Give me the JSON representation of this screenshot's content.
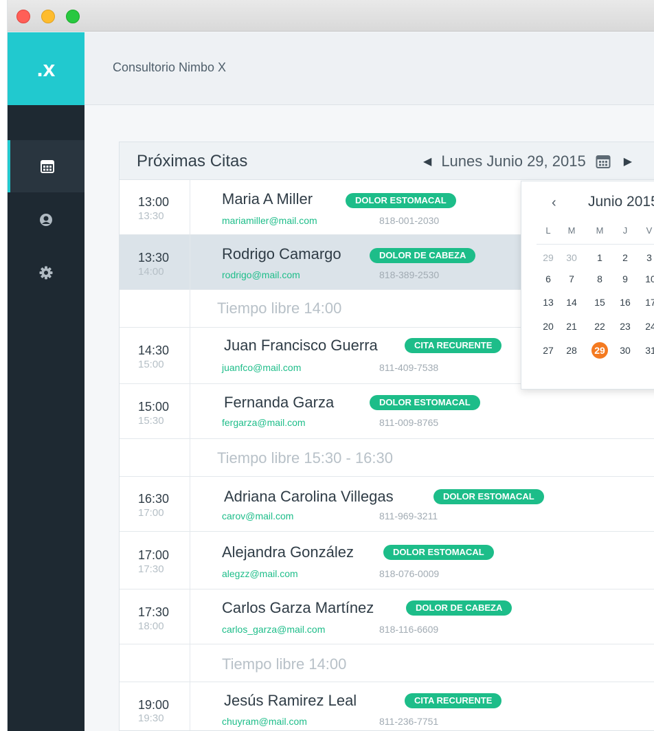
{
  "app": {
    "logo": ".x",
    "name": "Consultorio Nimbo X"
  },
  "sidebar": {
    "items": [
      {
        "icon": "calendar-icon",
        "active": true
      },
      {
        "icon": "user-icon",
        "active": false
      },
      {
        "icon": "gear-icon",
        "active": false
      }
    ]
  },
  "panel": {
    "title": "Próximas Citas",
    "date_prev": "◀",
    "date": "Lunes Junio 29, 2015",
    "date_next": "▶"
  },
  "appointments": [
    {
      "start": "13:00",
      "end": "13:30",
      "name": "Maria A Miller",
      "tag": "DOLOR ESTOMACAL",
      "email": "mariamiller@mail.com",
      "phone": "818-001-2030"
    },
    {
      "start": "13:30",
      "end": "14:00",
      "name": "Rodrigo Camargo",
      "tag": "DOLOR DE CABEZA",
      "email": "rodrigo@mail.com",
      "phone": "818-389-2530"
    },
    {
      "free": "Tiempo libre 14:00"
    },
    {
      "start": "14:30",
      "end": "15:00",
      "name": "Juan Francisco Guerra",
      "tag": "CITA RECURENTE",
      "email": "juanfco@mail.com",
      "phone": "811-409-7538"
    },
    {
      "start": "15:00",
      "end": "15:30",
      "name": "Fernanda Garza",
      "tag": "DOLOR ESTOMACAL",
      "email": "fergarza@mail.com",
      "phone": "811-009-8765"
    },
    {
      "free": "Tiempo libre 15:30 - 16:30"
    },
    {
      "start": "16:30",
      "end": "17:00",
      "name": "Adriana Carolina Villegas",
      "tag": "DOLOR ESTOMACAL",
      "email": "carov@mail.com",
      "phone": "811-969-3211"
    },
    {
      "start": "17:00",
      "end": "17:30",
      "name": "Alejandra González",
      "tag": "DOLOR ESTOMACAL",
      "email": "alegzz@mail.com",
      "phone": "818-076-0009"
    },
    {
      "start": "17:30",
      "end": "18:00",
      "name": "Carlos Garza Martínez",
      "tag": "DOLOR DE CABEZA",
      "email": "carlos_garza@mail.com",
      "phone": "818-116-6609"
    },
    {
      "free": "Tiempo libre 14:00"
    },
    {
      "start": "19:00",
      "end": "19:30",
      "name": "Jesús Ramirez Leal",
      "tag": "CITA RECURENTE",
      "email": "chuyram@mail.com",
      "phone": "811-236-7751"
    }
  ],
  "calendar": {
    "prev": "‹",
    "month": "Junio 2015",
    "weekdays": [
      "L",
      "M",
      "M",
      "J",
      "V"
    ],
    "weeks": [
      [
        "29",
        "30",
        "1",
        "2",
        "3"
      ],
      [
        "6",
        "7",
        "8",
        "9",
        "10"
      ],
      [
        "13",
        "14",
        "15",
        "16",
        "17"
      ],
      [
        "20",
        "21",
        "22",
        "23",
        "24"
      ],
      [
        "27",
        "28",
        "29",
        "30",
        "31"
      ]
    ],
    "selected": "29",
    "colors": {
      "accent": "#21c9cf",
      "tag": "#1dbd89",
      "today": "#f47a20"
    }
  }
}
